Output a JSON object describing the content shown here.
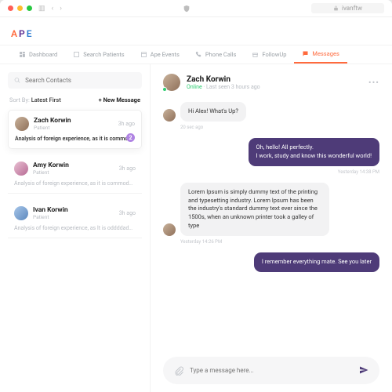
{
  "browser": {
    "url": "ivanftw"
  },
  "brand": {
    "letters": [
      "A",
      "P",
      "E"
    ]
  },
  "tabs": [
    {
      "label": "Dashboard"
    },
    {
      "label": "Search Patients"
    },
    {
      "label": "Ape Events"
    },
    {
      "label": "Phone Calls"
    },
    {
      "label": "FollowUp"
    },
    {
      "label": "Messages"
    }
  ],
  "sidebar": {
    "search_placeholder": "Search Contacts",
    "sort_label": "Sort By:",
    "sort_value": "Latest First",
    "new_message": "+ New Message",
    "contacts": [
      {
        "name": "Zach Korwin",
        "role": "Patient",
        "time": "3h ago",
        "preview": "Analysis of foreign experience, as it is commo...",
        "unread": "2"
      },
      {
        "name": "Amy Korwin",
        "role": "Patient",
        "time": "3h ago",
        "preview": "Analysis of foreign experience, as it is commodata..."
      },
      {
        "name": "Ivan Korwin",
        "role": "Patient",
        "time": "3h ago",
        "preview": "Analysis of foreign experience, as It is oddddadddd..."
      }
    ]
  },
  "chat": {
    "name": "Zach Korwin",
    "status_online": "Online",
    "status_dot": " · ",
    "status_last": "Last seen 3 hours ago",
    "messages": [
      {
        "side": "in",
        "text": "Hi Alex! What's Up?",
        "time": "20 sec ago"
      },
      {
        "side": "out",
        "text": "Oh, hello! All perfectly.\nI work, study and know this wonderful world!",
        "time": "Yesterday 14:38 PM"
      },
      {
        "side": "in",
        "text": "Lorem Ipsum is simply dummy text of the printing and typesetting industry. Lorem Ipsum has been the industry's standard dummy text ever since the 1500s, when an unknown printer took a galley of type",
        "time": "Yesterday 14:26 PM"
      },
      {
        "side": "out",
        "text": "I remember everything mate. See you later",
        "time": ""
      }
    ],
    "composer_placeholder": "Type a message here..."
  }
}
